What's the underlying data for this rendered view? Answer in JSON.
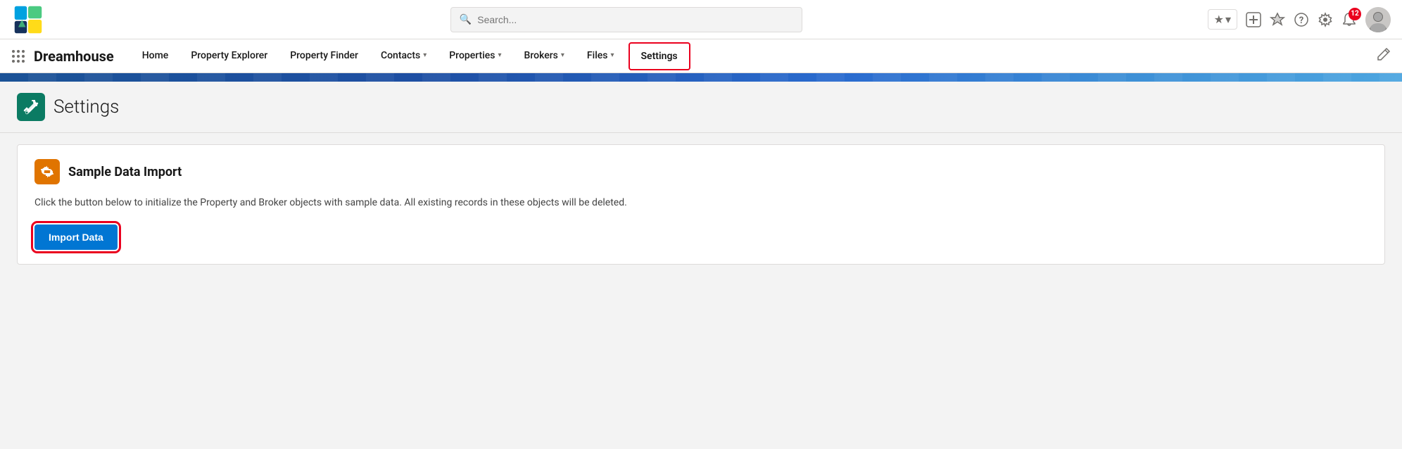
{
  "utility_bar": {
    "search_placeholder": "Search...",
    "favorites_star": "★",
    "favorites_chevron": "▾",
    "add_icon": "+",
    "salesforce_icon": "⬡",
    "help_icon": "?",
    "setup_icon": "⚙",
    "notification_count": "12",
    "notification_icon": "🔔"
  },
  "nav": {
    "app_name": "Dreamhouse",
    "home_label": "Home",
    "property_explorer_label": "Property Explorer",
    "property_finder_label": "Property Finder",
    "contacts_label": "Contacts",
    "properties_label": "Properties",
    "brokers_label": "Brokers",
    "files_label": "Files",
    "settings_label": "Settings"
  },
  "page": {
    "title": "Settings",
    "card_title": "Sample Data Import",
    "card_description": "Click the button below to initialize the Property and Broker objects with sample data. All existing records in these objects will be deleted.",
    "import_button_label": "Import Data"
  },
  "colors": {
    "accent_blue": "#0176d3",
    "active_red": "#ea001e",
    "teal": "#0b7b63",
    "orange": "#e07400"
  }
}
